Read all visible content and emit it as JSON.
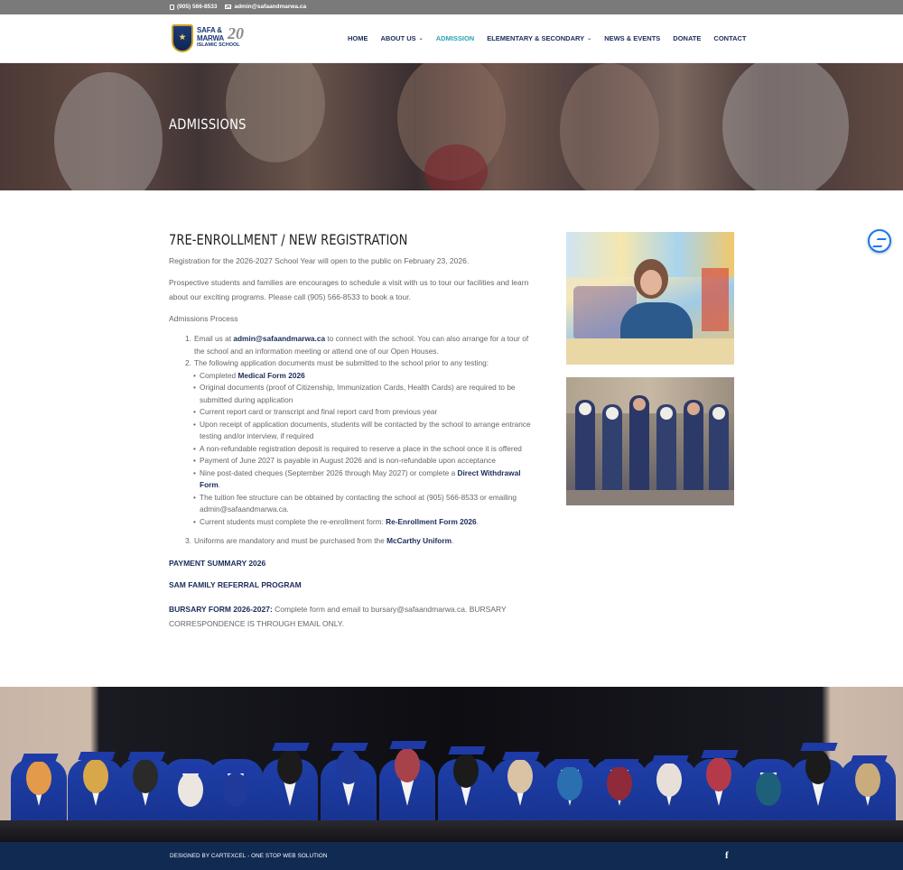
{
  "topbar": {
    "phone": "(905) 566-8533",
    "email": "admin@safaandmarwa.ca"
  },
  "logo": {
    "line1": "SAFA &",
    "line2": "MARWA",
    "line3": "ISLAMIC SCHOOL",
    "badge": "20"
  },
  "nav": {
    "items": [
      {
        "label": "HOME"
      },
      {
        "label": "ABOUT US",
        "has_dropdown": true
      },
      {
        "label": "ADMISSION",
        "active": true
      },
      {
        "label": "ELEMENTARY & SECONDARY",
        "has_dropdown": true
      },
      {
        "label": "NEWS & EVENTS"
      },
      {
        "label": "DONATE"
      },
      {
        "label": "CONTACT"
      }
    ],
    "dropdown_glyph": "⌄"
  },
  "hero": {
    "title": "ADMISSIONS"
  },
  "main": {
    "heading": "7RE-ENROLLMENT / NEW REGISTRATION",
    "p1": "Registration for the 2026-2027 School Year will open to the public on February 23, 2026.",
    "p2": "Prospective students and families are encourages to schedule a visit with us to tour our facilities and learn about our exciting programs.  Please call (905) 566-8533 to book a tour.",
    "p3": "Admissions Process",
    "step1_num": "1.",
    "step1_pre": "Email us at ",
    "step1_link": "admin@safaandmarwa.ca",
    "step1_post": " to connect with the school. You can also arrange for a tour of the school and an information meeting or attend one of our Open Houses.",
    "step2_num": "2.",
    "step2": "The following application documents must be submitted to the school prior to any testing:",
    "bullet_glyph": "•",
    "b1_pre": "Completed ",
    "b1_link": "Medical Form 2026",
    "b2": "Original documents (proof of Citizenship, Immunization Cards, Health Cards) are required to be submitted during application",
    "b3": "Current report card or transcript and final report card from previous year",
    "b4": "Upon receipt of application documents, students will be contacted by the school to arrange entrance testing and/or interview, if required",
    "b5": "A non-refundable registration deposit is required to reserve a place in the school once it is offered",
    "b6": "Payment of June 2027 is payable in August 2026 and is non-refundable upon acceptance",
    "b7_pre": "Nine post-dated cheques (September 2026 through May 2027) or complete a ",
    "b7_link": "Direct Withdrawal Form",
    "b7_post": ".",
    "b8": "The tuition fee structure can be obtained by contacting the school at (905) 566-8533 or emailing admin@safaandmarwa.ca.",
    "b9_pre": "Current students must complete the re-enrollment form: ",
    "b9_link": "Re-Enrollment Form 2026",
    "b9_post": ".",
    "step3_num": "3.",
    "step3_pre": "Uniforms are mandatory and must be purchased from the ",
    "step3_link": "McCarthy Uniform",
    "step3_post": ".",
    "payment_summary": "PAYMENT SUMMARY 2026",
    "referral": "SAM FAMILY REFERRAL PROGRAM",
    "bursary_link": "BURSARY FORM 2026-2027:",
    "bursary_text": " Complete form and email to bursary@safaandmarwa.ca. BURSARY CORRESPONDENCE IS THROUGH EMAIL ONLY."
  },
  "footer": {
    "credit": "DESIGNED BY CARTEXCEL - ONE STOP WEB SOLUTION",
    "fb_glyph": "f"
  },
  "colors": {
    "nav_text": "#1b2c5a",
    "active": "#2ea3b7",
    "footer_bg": "#102a52",
    "topbar_bg": "#7a7a7a"
  }
}
